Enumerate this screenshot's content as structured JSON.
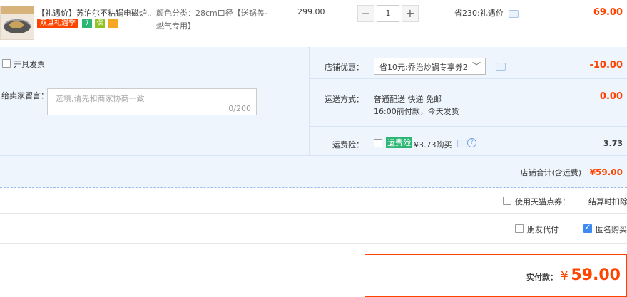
{
  "item": {
    "title": "【礼遇价】苏泊尔不粘锅电磁炉...",
    "promo_tag": "双旦礼遇季",
    "icons": [
      {
        "name": "seven-days-return-icon",
        "label": "7",
        "color": "#2bb673"
      },
      {
        "name": "shield-icon",
        "label": "保",
        "color": "#8fc31f"
      },
      {
        "name": "card-icon",
        "label": "",
        "color": "#f5a623"
      }
    ],
    "sku_line1": "颜色分类：28cm口径【送锅盖-",
    "sku_line2": "燃气专用】",
    "price": "299.00",
    "quantity": "1",
    "minus": "−",
    "plus": "+",
    "savings": "省230:礼遇价",
    "subtotal": "69.00"
  },
  "invoice": {
    "label": "开具发票"
  },
  "message": {
    "label": "给卖家留言：",
    "placeholder": "选填,请先和商家协商一致",
    "counter": "0/200"
  },
  "shop_coupon": {
    "label": "店铺优惠：",
    "selected": "省10元:乔治炒锅专享券2",
    "amount": "-10.00"
  },
  "shipping": {
    "label": "运送方式：",
    "method": "普通配送 快递 免邮",
    "note": "16:00前付款，今天发货",
    "amount": "0.00"
  },
  "insurance": {
    "label": "运费险：",
    "badge": "运费险",
    "text": "¥3.73购买",
    "amount": "3.73"
  },
  "shop_total": {
    "label": "店铺合计(含运费)",
    "amount": "¥59.00"
  },
  "tmall_points": {
    "label": "使用天猫点券：",
    "note": "结算时扣除"
  },
  "friend_pay": {
    "label": "朋友代付"
  },
  "anonymous": {
    "label": "匿名购买",
    "checked": true
  },
  "actual_pay": {
    "label": "实付款：",
    "currency": "¥",
    "amount": "59.00"
  }
}
